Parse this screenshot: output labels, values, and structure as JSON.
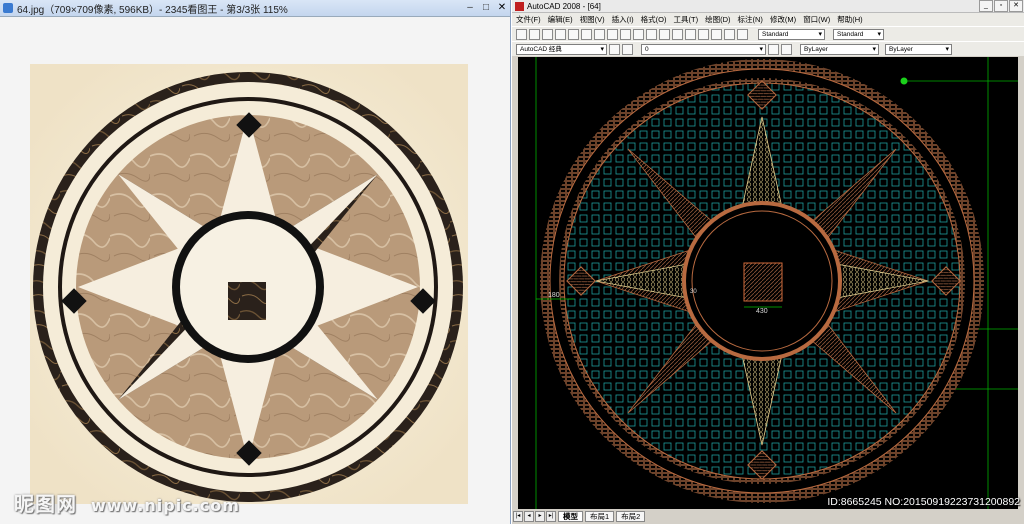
{
  "viewer": {
    "title": "64.jpg（709×709像素, 596KB）- 2345看图王 - 第3/3张 115%",
    "min": "–",
    "max": "□",
    "close": "✕"
  },
  "watermark_left": {
    "brand": "昵图网",
    "url": "www.nipic.com"
  },
  "cad": {
    "title": "AutoCAD 2008 - [64]",
    "menus": [
      "文件(F)",
      "编辑(E)",
      "视图(V)",
      "插入(I)",
      "格式(O)",
      "工具(T)",
      "绘图(D)",
      "标注(N)",
      "修改(M)",
      "窗口(W)",
      "帮助(H)"
    ],
    "workspace": "AutoCAD 经典",
    "layer": "0",
    "text_style": "Standard",
    "dim_style": "Standard",
    "color": "ByLayer",
    "linetype": "ByLayer",
    "tabs": [
      "模型",
      "布局1",
      "布局2"
    ],
    "dims": {
      "inner": "430",
      "left": "180",
      "small": "30"
    }
  },
  "watermark_right": "ID:8665245 NO:20150919223731200892",
  "colors": {
    "cream": "#f3ead6",
    "tan": "#b99a7a",
    "dark_marble": "#2a211b",
    "cad_bg": "#000000",
    "cad_green": "#00d000",
    "cad_brown": "#8a5438",
    "cad_teal": "#1f9c9c"
  }
}
